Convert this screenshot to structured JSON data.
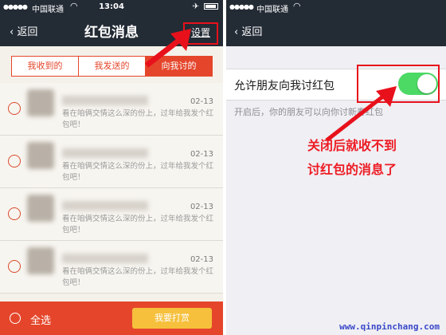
{
  "left": {
    "status": {
      "carrier": "中国联通",
      "time": "13:04",
      "right": "✈ 🔋"
    },
    "nav": {
      "back": "返回",
      "title": "红包消息",
      "settings": "设置"
    },
    "tabs": [
      "我收到的",
      "我发送的",
      "向我讨的"
    ],
    "rows": [
      {
        "date": "02-13",
        "message": "看在咱俩交情这么深的份上，过年给我发个红包吧！"
      },
      {
        "date": "02-13",
        "message": "看在咱俩交情这么深的份上，过年给我发个红包吧！"
      },
      {
        "date": "02-13",
        "message": "看在咱俩交情这么深的份上，过年给我发个红包吧！"
      },
      {
        "date": "02-13",
        "message": "看在咱俩交情这么深的份上，过年给我发个红包吧！"
      }
    ],
    "bottom": {
      "select_all": "全选",
      "reward": "我要打赏"
    }
  },
  "right": {
    "status": {
      "carrier": "中国联通"
    },
    "nav": {
      "back": "返回"
    },
    "setting": {
      "label": "允许朋友向我讨红包",
      "enabled": true
    },
    "hint": "开启后，你的朋友可以向你讨新春红包"
  },
  "annotation": {
    "line1": "关闭后就收不到",
    "line2": "讨红包的消息了"
  },
  "watermark": "www.qinpinchang.com",
  "colors": {
    "accent": "#e5462b",
    "highlight": "#e8111b",
    "toggle": "#4cd964",
    "navbar": "#232b35"
  }
}
